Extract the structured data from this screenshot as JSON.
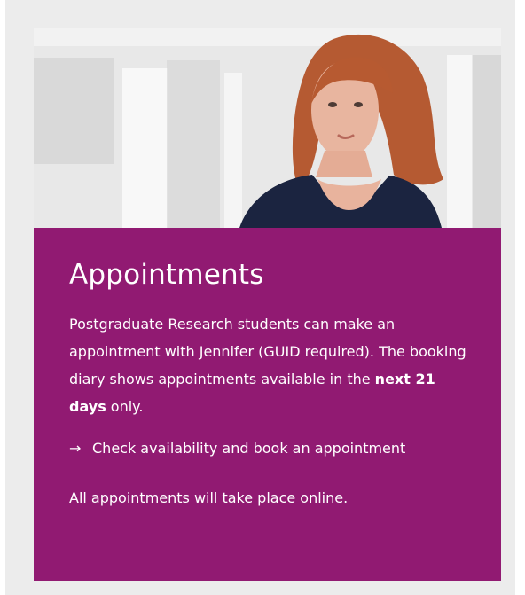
{
  "appointments_card": {
    "image": {
      "subject": "portrait-photo",
      "description": ""
    },
    "title": "Appointments",
    "description": {
      "text_before": "Postgraduate Research students can make an appointment with Jennifer (GUID required). The booking diary shows appointments available in the ",
      "highlight": "next 21 days",
      "text_after": " only."
    },
    "cta": {
      "arrow": "→",
      "label": "Check availability and book an appointment"
    },
    "note": "All appointments will take place online."
  },
  "colors": {
    "card_background": "#911a72",
    "panel_background": "#ececec",
    "text": "#ffffff"
  }
}
